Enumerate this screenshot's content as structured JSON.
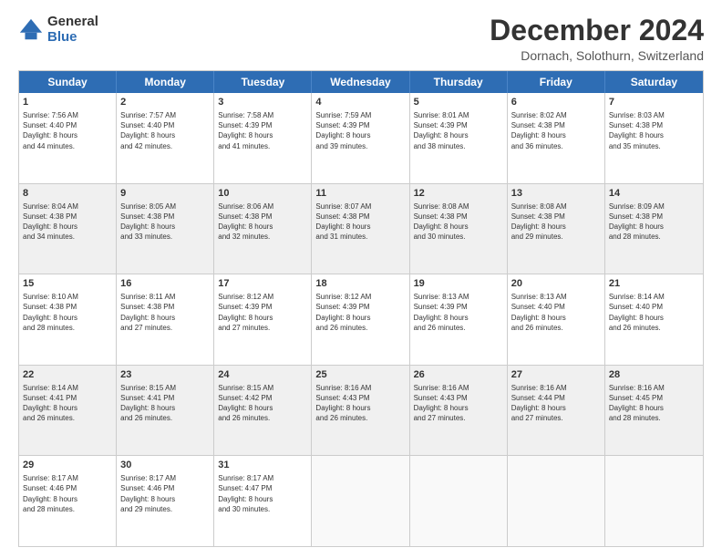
{
  "logo": {
    "general": "General",
    "blue": "Blue"
  },
  "title": "December 2024",
  "location": "Dornach, Solothurn, Switzerland",
  "header_days": [
    "Sunday",
    "Monday",
    "Tuesday",
    "Wednesday",
    "Thursday",
    "Friday",
    "Saturday"
  ],
  "weeks": [
    [
      {
        "day": "1",
        "lines": [
          "Sunrise: 7:56 AM",
          "Sunset: 4:40 PM",
          "Daylight: 8 hours",
          "and 44 minutes."
        ]
      },
      {
        "day": "2",
        "lines": [
          "Sunrise: 7:57 AM",
          "Sunset: 4:40 PM",
          "Daylight: 8 hours",
          "and 42 minutes."
        ]
      },
      {
        "day": "3",
        "lines": [
          "Sunrise: 7:58 AM",
          "Sunset: 4:39 PM",
          "Daylight: 8 hours",
          "and 41 minutes."
        ]
      },
      {
        "day": "4",
        "lines": [
          "Sunrise: 7:59 AM",
          "Sunset: 4:39 PM",
          "Daylight: 8 hours",
          "and 39 minutes."
        ]
      },
      {
        "day": "5",
        "lines": [
          "Sunrise: 8:01 AM",
          "Sunset: 4:39 PM",
          "Daylight: 8 hours",
          "and 38 minutes."
        ]
      },
      {
        "day": "6",
        "lines": [
          "Sunrise: 8:02 AM",
          "Sunset: 4:38 PM",
          "Daylight: 8 hours",
          "and 36 minutes."
        ]
      },
      {
        "day": "7",
        "lines": [
          "Sunrise: 8:03 AM",
          "Sunset: 4:38 PM",
          "Daylight: 8 hours",
          "and 35 minutes."
        ]
      }
    ],
    [
      {
        "day": "8",
        "lines": [
          "Sunrise: 8:04 AM",
          "Sunset: 4:38 PM",
          "Daylight: 8 hours",
          "and 34 minutes."
        ]
      },
      {
        "day": "9",
        "lines": [
          "Sunrise: 8:05 AM",
          "Sunset: 4:38 PM",
          "Daylight: 8 hours",
          "and 33 minutes."
        ]
      },
      {
        "day": "10",
        "lines": [
          "Sunrise: 8:06 AM",
          "Sunset: 4:38 PM",
          "Daylight: 8 hours",
          "and 32 minutes."
        ]
      },
      {
        "day": "11",
        "lines": [
          "Sunrise: 8:07 AM",
          "Sunset: 4:38 PM",
          "Daylight: 8 hours",
          "and 31 minutes."
        ]
      },
      {
        "day": "12",
        "lines": [
          "Sunrise: 8:08 AM",
          "Sunset: 4:38 PM",
          "Daylight: 8 hours",
          "and 30 minutes."
        ]
      },
      {
        "day": "13",
        "lines": [
          "Sunrise: 8:08 AM",
          "Sunset: 4:38 PM",
          "Daylight: 8 hours",
          "and 29 minutes."
        ]
      },
      {
        "day": "14",
        "lines": [
          "Sunrise: 8:09 AM",
          "Sunset: 4:38 PM",
          "Daylight: 8 hours",
          "and 28 minutes."
        ]
      }
    ],
    [
      {
        "day": "15",
        "lines": [
          "Sunrise: 8:10 AM",
          "Sunset: 4:38 PM",
          "Daylight: 8 hours",
          "and 28 minutes."
        ]
      },
      {
        "day": "16",
        "lines": [
          "Sunrise: 8:11 AM",
          "Sunset: 4:38 PM",
          "Daylight: 8 hours",
          "and 27 minutes."
        ]
      },
      {
        "day": "17",
        "lines": [
          "Sunrise: 8:12 AM",
          "Sunset: 4:39 PM",
          "Daylight: 8 hours",
          "and 27 minutes."
        ]
      },
      {
        "day": "18",
        "lines": [
          "Sunrise: 8:12 AM",
          "Sunset: 4:39 PM",
          "Daylight: 8 hours",
          "and 26 minutes."
        ]
      },
      {
        "day": "19",
        "lines": [
          "Sunrise: 8:13 AM",
          "Sunset: 4:39 PM",
          "Daylight: 8 hours",
          "and 26 minutes."
        ]
      },
      {
        "day": "20",
        "lines": [
          "Sunrise: 8:13 AM",
          "Sunset: 4:40 PM",
          "Daylight: 8 hours",
          "and 26 minutes."
        ]
      },
      {
        "day": "21",
        "lines": [
          "Sunrise: 8:14 AM",
          "Sunset: 4:40 PM",
          "Daylight: 8 hours",
          "and 26 minutes."
        ]
      }
    ],
    [
      {
        "day": "22",
        "lines": [
          "Sunrise: 8:14 AM",
          "Sunset: 4:41 PM",
          "Daylight: 8 hours",
          "and 26 minutes."
        ]
      },
      {
        "day": "23",
        "lines": [
          "Sunrise: 8:15 AM",
          "Sunset: 4:41 PM",
          "Daylight: 8 hours",
          "and 26 minutes."
        ]
      },
      {
        "day": "24",
        "lines": [
          "Sunrise: 8:15 AM",
          "Sunset: 4:42 PM",
          "Daylight: 8 hours",
          "and 26 minutes."
        ]
      },
      {
        "day": "25",
        "lines": [
          "Sunrise: 8:16 AM",
          "Sunset: 4:43 PM",
          "Daylight: 8 hours",
          "and 26 minutes."
        ]
      },
      {
        "day": "26",
        "lines": [
          "Sunrise: 8:16 AM",
          "Sunset: 4:43 PM",
          "Daylight: 8 hours",
          "and 27 minutes."
        ]
      },
      {
        "day": "27",
        "lines": [
          "Sunrise: 8:16 AM",
          "Sunset: 4:44 PM",
          "Daylight: 8 hours",
          "and 27 minutes."
        ]
      },
      {
        "day": "28",
        "lines": [
          "Sunrise: 8:16 AM",
          "Sunset: 4:45 PM",
          "Daylight: 8 hours",
          "and 28 minutes."
        ]
      }
    ],
    [
      {
        "day": "29",
        "lines": [
          "Sunrise: 8:17 AM",
          "Sunset: 4:46 PM",
          "Daylight: 8 hours",
          "and 28 minutes."
        ]
      },
      {
        "day": "30",
        "lines": [
          "Sunrise: 8:17 AM",
          "Sunset: 4:46 PM",
          "Daylight: 8 hours",
          "and 29 minutes."
        ]
      },
      {
        "day": "31",
        "lines": [
          "Sunrise: 8:17 AM",
          "Sunset: 4:47 PM",
          "Daylight: 8 hours",
          "and 30 minutes."
        ]
      },
      {
        "day": "",
        "lines": []
      },
      {
        "day": "",
        "lines": []
      },
      {
        "day": "",
        "lines": []
      },
      {
        "day": "",
        "lines": []
      }
    ]
  ]
}
